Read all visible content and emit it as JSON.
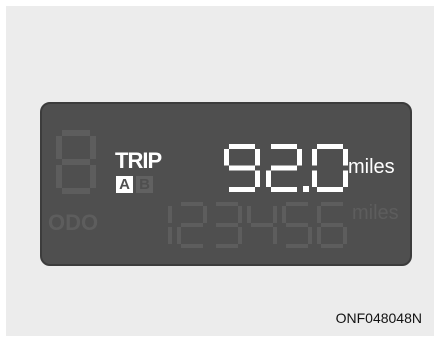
{
  "display": {
    "trip_label": "TRIP",
    "trip_a": "A",
    "trip_b": "B",
    "trip_value": "92.0",
    "trip_unit": "miles",
    "odo_label": "ODO",
    "odo_value": "123456",
    "odo_unit": "miles",
    "selected_trip": "A",
    "colors": {
      "lit": "#ffffff",
      "unlit": "#5d5d5d",
      "panel": "#4f4f4f",
      "background": "#ececec"
    }
  },
  "caption": "ONF048048N"
}
